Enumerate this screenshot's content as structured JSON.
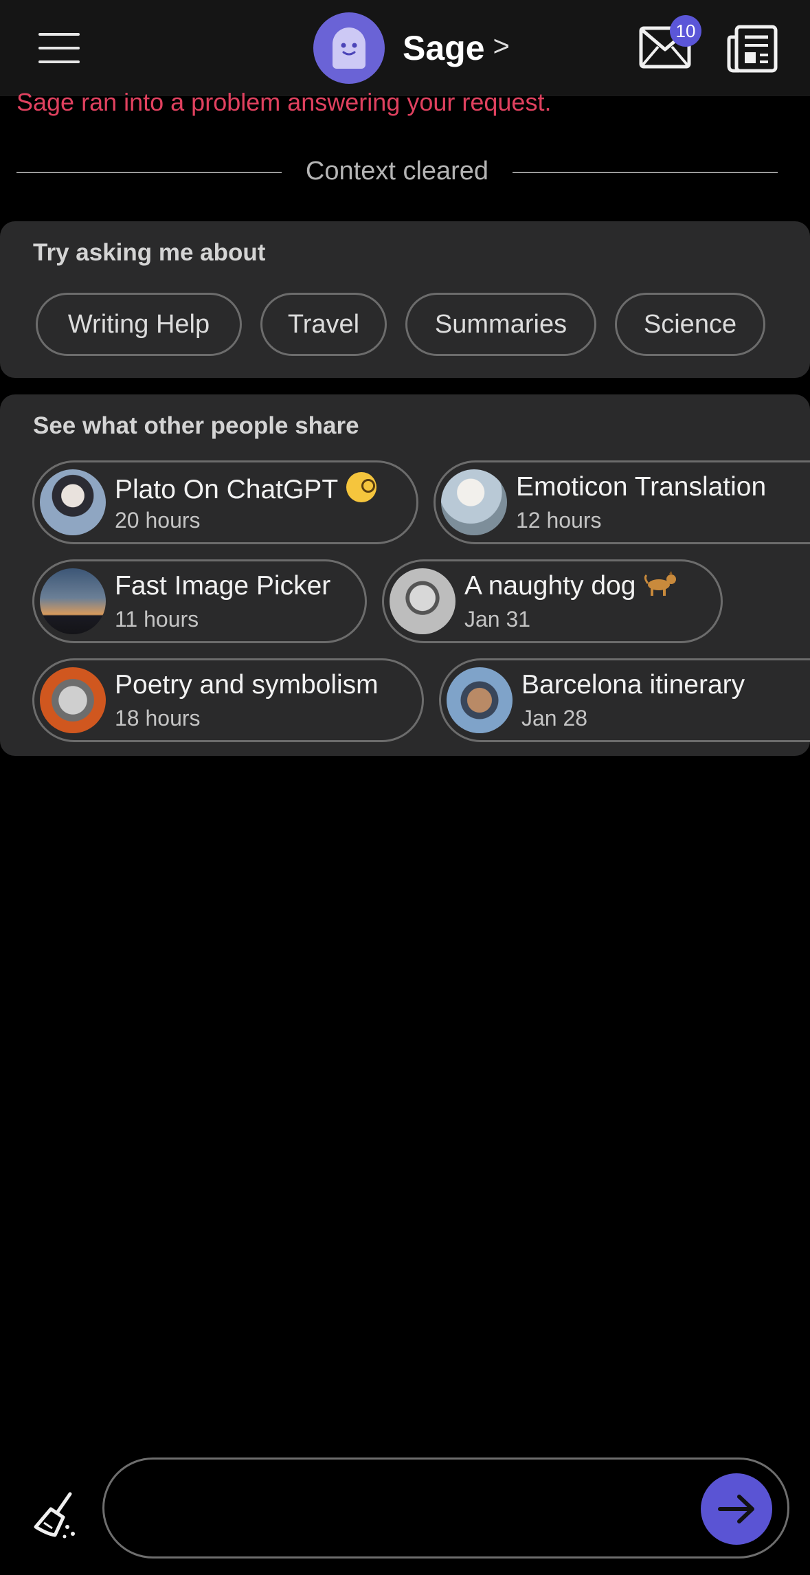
{
  "header": {
    "bot_name": "Sage",
    "bot_chevron": ">",
    "mail_badge_count": "10",
    "accent_color": "#5b56d8"
  },
  "error_message": "Sage ran into a problem answering your request.",
  "divider_label": "Context cleared",
  "suggestions": {
    "title": "Try asking me about",
    "chips": [
      "Writing Help",
      "Travel",
      "Summaries",
      "Science"
    ]
  },
  "shared": {
    "title": "See what other people share",
    "items": [
      {
        "title": "Plato On ChatGPT",
        "time": "20 hours",
        "emoji": "face-with-monocle"
      },
      {
        "title": "Emoticon Translation",
        "time": "12 hours"
      },
      {
        "title": "Fast Image Picker",
        "time": "11 hours"
      },
      {
        "title": "A naughty dog",
        "time": "Jan 31",
        "emoji": "dog"
      },
      {
        "title": "Poetry and symbolism",
        "time": "18 hours"
      },
      {
        "title": "Barcelona itinerary",
        "time": "Jan 28"
      }
    ]
  },
  "composer": {
    "value": "",
    "placeholder": ""
  }
}
